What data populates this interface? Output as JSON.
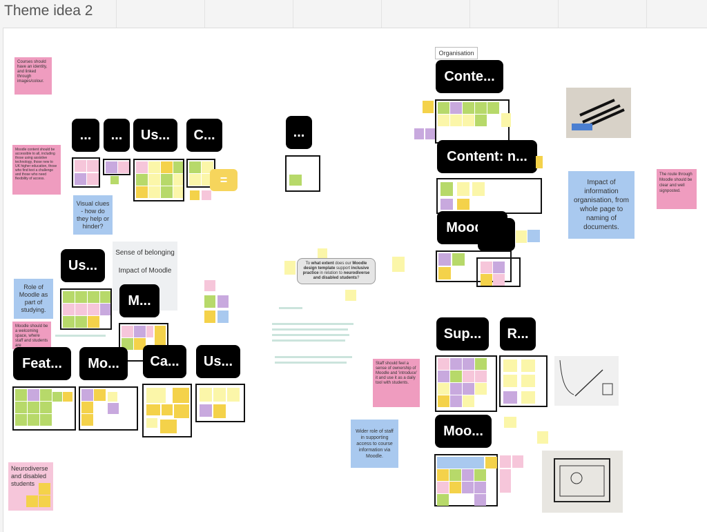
{
  "board": {
    "title": "Theme idea 2"
  },
  "labels": {
    "l1": "...",
    "l2": "...",
    "l3": "Us...",
    "l4": "C...",
    "l5": "...",
    "l6": "Us...",
    "l7": "M...",
    "l8": "Feat...",
    "l9": "Mo...",
    "l10": "Ca...",
    "l11": "Us...",
    "l12": "Conte...",
    "l13": "Content: n...",
    "l14": "Moodl...",
    "l15": "Sup...",
    "l16": "R...",
    "l17": "Moo..."
  },
  "notes": {
    "courses_identity": "Courses should have an identity, and linked through images/colour.",
    "moodle_accessible": "Moodle content should be accessible to all, including those using assistive technology, those new to UK higher education, those who find text a challenge and those who need flexibility of access.",
    "visual_clues": "Visual clues - how do they help or hinder?",
    "sense_belonging": "Sense of belonging\n\nImpact of Moodle",
    "role_of_moodle": "Role of Moodle as part of studying.",
    "welcoming_space": "Moodle should be a welcoming space, where staff and students are",
    "neurodiverse": "Neurodiverse and disabled students",
    "impact_info_org": "Impact of information organisation, from whole page to naming of documents.",
    "route_through": "The route through Moodle should be clear and well signposted.",
    "staff_ownership": "Staff should feel a sense of ownership of Moodle and 'introduce' it and use it as a daily tool with students.",
    "wider_role": "Wider role of staff in supporting access to course information via Moodle.",
    "organisation_tag": "Organisation",
    "central_q_pre": "To ",
    "central_q_b1": "what extent",
    "central_q_mid": " does our ",
    "central_q_b2": "Moodle design template",
    "central_q_mid2": " support ",
    "central_q_b3": "inclusive practice",
    "central_q_mid3": " in relation to ",
    "central_q_b4": "neurodiverse and disabled students",
    "central_q_end": "?"
  },
  "colors": {
    "yellow": "#f4d24a",
    "light_yellow": "#fbf6a9",
    "green": "#b7d96a",
    "pink": "#f6c6da",
    "purple": "#c8a9de",
    "blue": "#a9c9ef",
    "hot_pink": "#ef9cbf",
    "label_bg": "#000000"
  }
}
